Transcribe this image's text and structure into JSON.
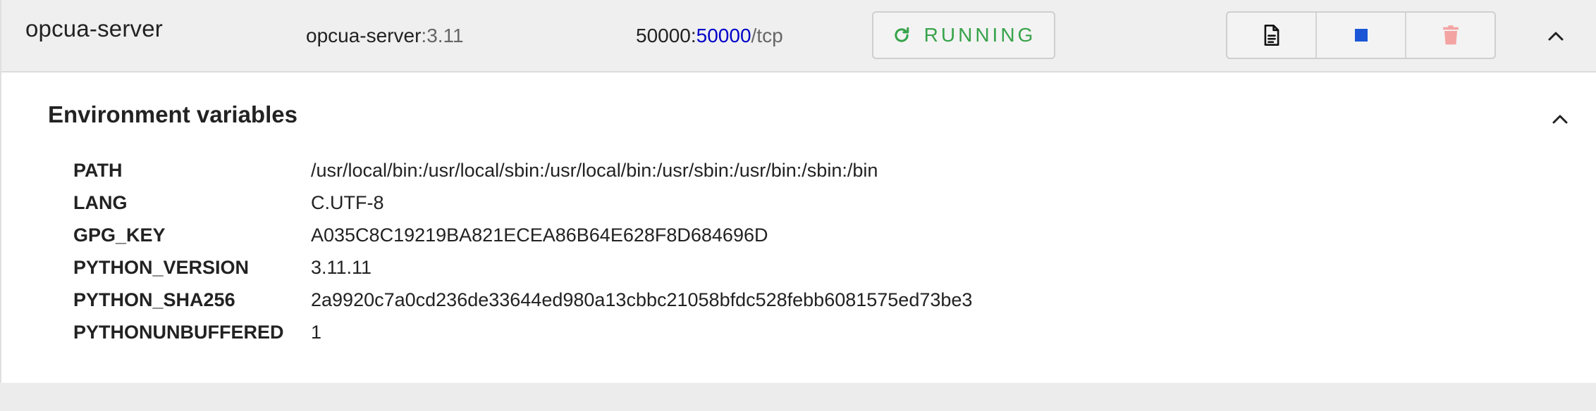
{
  "container": {
    "name": "opcua-server",
    "image_name": "opcua-server",
    "image_sep": ":",
    "image_tag": "3.11",
    "port_container": "50000",
    "port_sep": ":",
    "port_host": "50000",
    "port_proto": "/tcp",
    "status": "RUNNING",
    "status_color": "#37a34a",
    "actions": [
      {
        "icon": "document-icon",
        "label": "logs"
      },
      {
        "icon": "stop-icon",
        "label": "stop",
        "color": "#1a56d6"
      },
      {
        "icon": "trash-icon",
        "label": "delete",
        "color": "#f4a3a3"
      }
    ]
  },
  "env": {
    "title": "Environment variables",
    "vars": [
      {
        "key": "PATH",
        "value": "/usr/local/bin:/usr/local/sbin:/usr/local/bin:/usr/sbin:/usr/bin:/sbin:/bin"
      },
      {
        "key": "LANG",
        "value": "C.UTF-8"
      },
      {
        "key": "GPG_KEY",
        "value": "A035C8C19219BA821ECEA86B64E628F8D684696D"
      },
      {
        "key": "PYTHON_VERSION",
        "value": "3.11.11"
      },
      {
        "key": "PYTHON_SHA256",
        "value": "2a9920c7a0cd236de33644ed980a13cbbc21058bfdc528febb6081575ed73be3"
      },
      {
        "key": "PYTHONUNBUFFERED",
        "value": "1"
      }
    ]
  }
}
